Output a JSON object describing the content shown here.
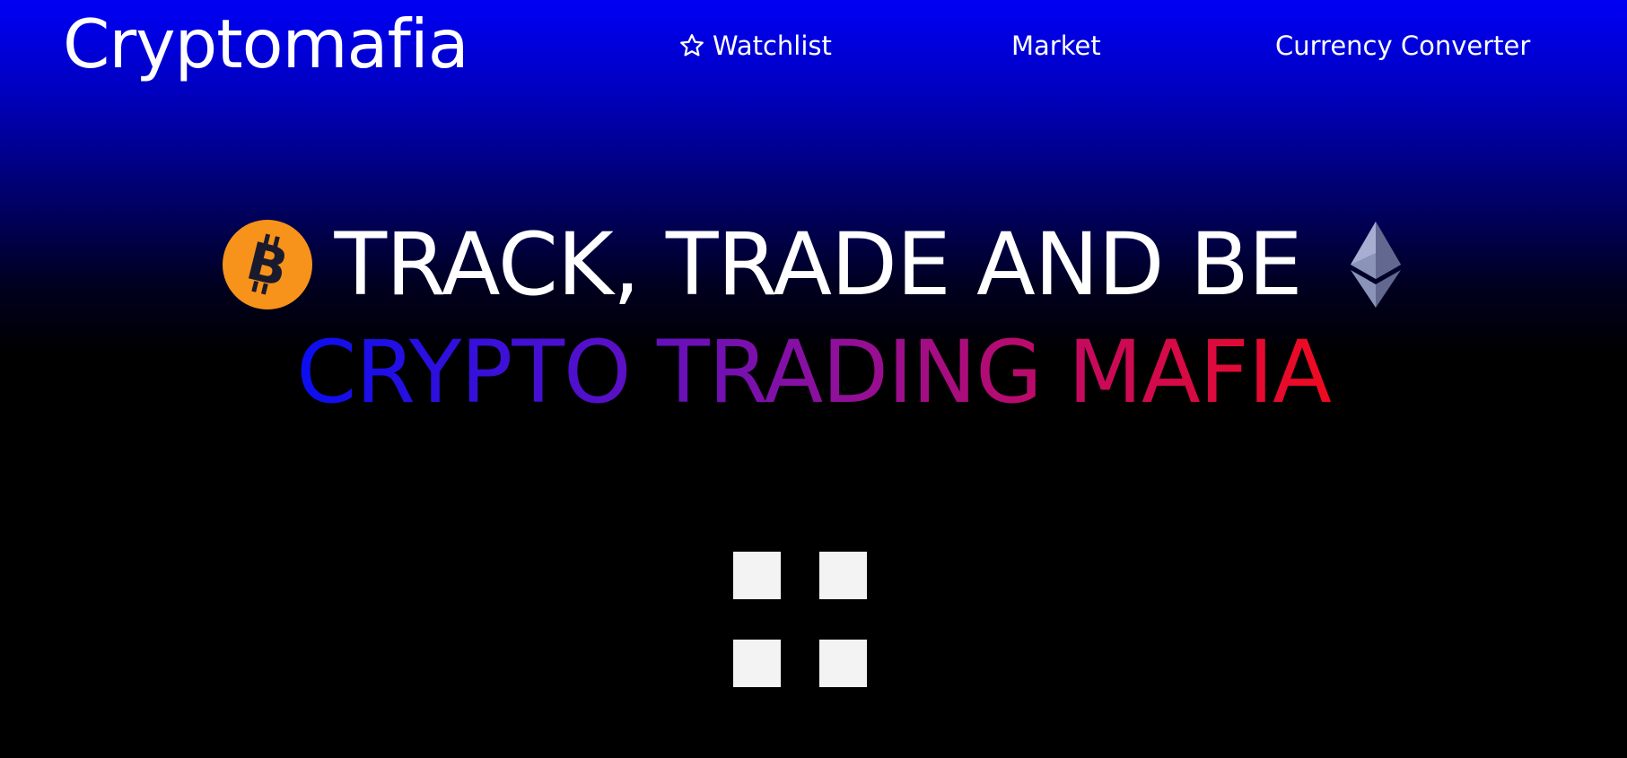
{
  "header": {
    "brand": "Cryptomafia",
    "nav": {
      "watchlist": "Watchlist",
      "market": "Market",
      "converter": "Currency Converter"
    }
  },
  "hero": {
    "line1": "TRACK, TRADE AND BE",
    "line2": "CRYPTO TRADING MAFIA",
    "icons": {
      "left": "bitcoin-icon",
      "right": "ethereum-icon"
    },
    "colors": {
      "gradient_start": "#0a0ef0",
      "gradient_end": "#f00a20",
      "bitcoin": "#f7931a"
    }
  },
  "loader": {
    "icon": "loading-squares-icon"
  }
}
